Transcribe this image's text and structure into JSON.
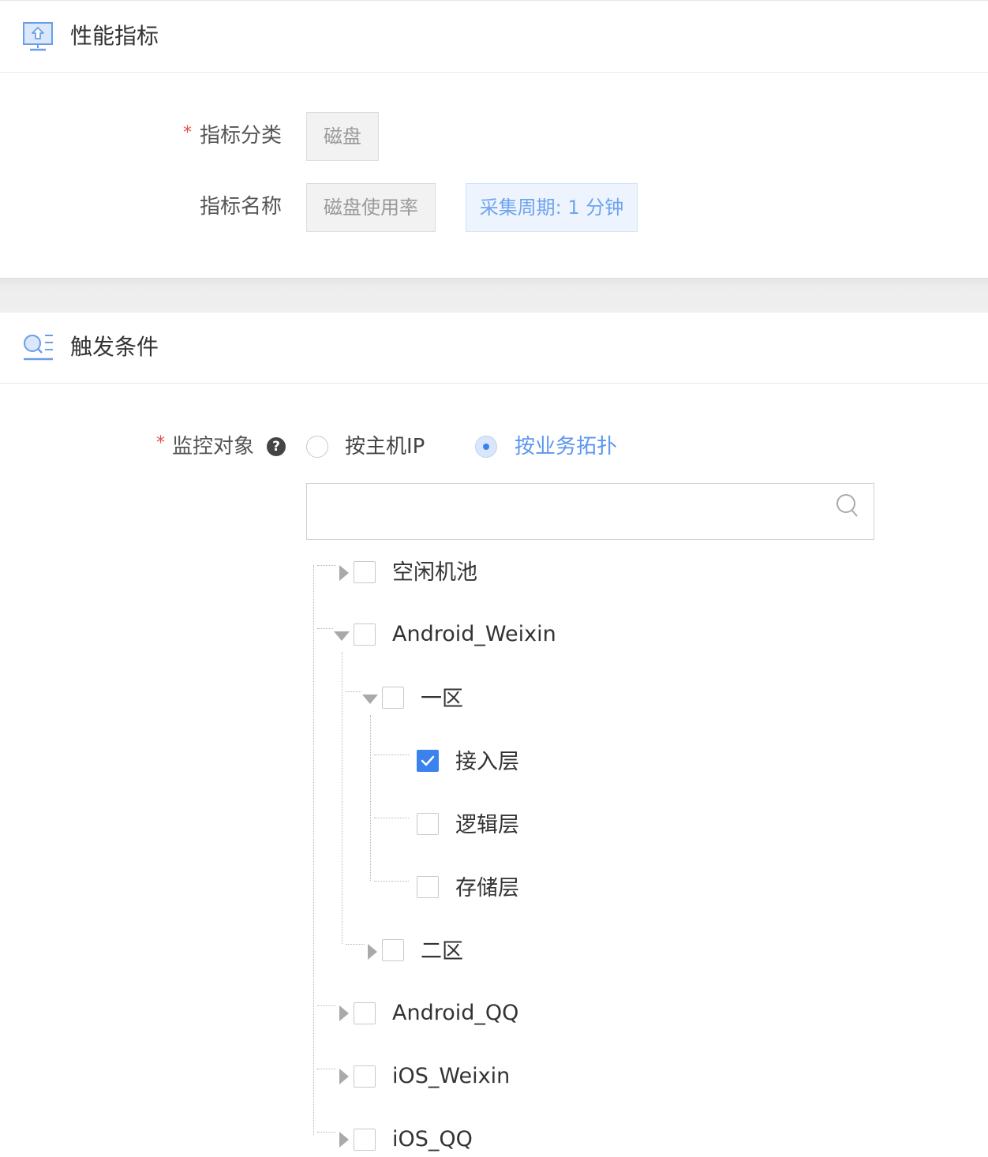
{
  "section_metric": {
    "title": "性能指标",
    "icon": "monitor-upload-icon",
    "category_label": "指标分类",
    "category_value": "磁盘",
    "name_label": "指标名称",
    "name_value": "磁盘使用率",
    "period_tag": "采集周期: 1 分钟",
    "required_mark": "*"
  },
  "section_trigger": {
    "title": "触发条件",
    "icon": "search-list-icon",
    "target_label": "监控对象",
    "required_mark": "*",
    "help_glyph": "?",
    "radio_options": [
      {
        "label": "按主机IP",
        "selected": false
      },
      {
        "label": "按业务拓扑",
        "selected": true
      }
    ],
    "search": {
      "value": "",
      "placeholder": ""
    },
    "tree": [
      {
        "label": "空闲机池",
        "state": "collapsed",
        "checked": false
      },
      {
        "label": "Android_Weixin",
        "state": "expanded",
        "checked": false
      },
      {
        "label": "一区",
        "state": "expanded",
        "checked": false
      },
      {
        "label": "接入层",
        "state": "leaf",
        "checked": true
      },
      {
        "label": "逻辑层",
        "state": "leaf",
        "checked": false
      },
      {
        "label": "存储层",
        "state": "leaf",
        "checked": false
      },
      {
        "label": "二区",
        "state": "collapsed",
        "checked": false
      },
      {
        "label": "Android_QQ",
        "state": "collapsed",
        "checked": false
      },
      {
        "label": "iOS_Weixin",
        "state": "collapsed",
        "checked": false
      },
      {
        "label": "iOS_QQ",
        "state": "collapsed",
        "checked": false
      }
    ]
  },
  "colors": {
    "accent": "#3b82ee",
    "accent_light": "#6fa3ee",
    "required": "#e84c4c"
  }
}
